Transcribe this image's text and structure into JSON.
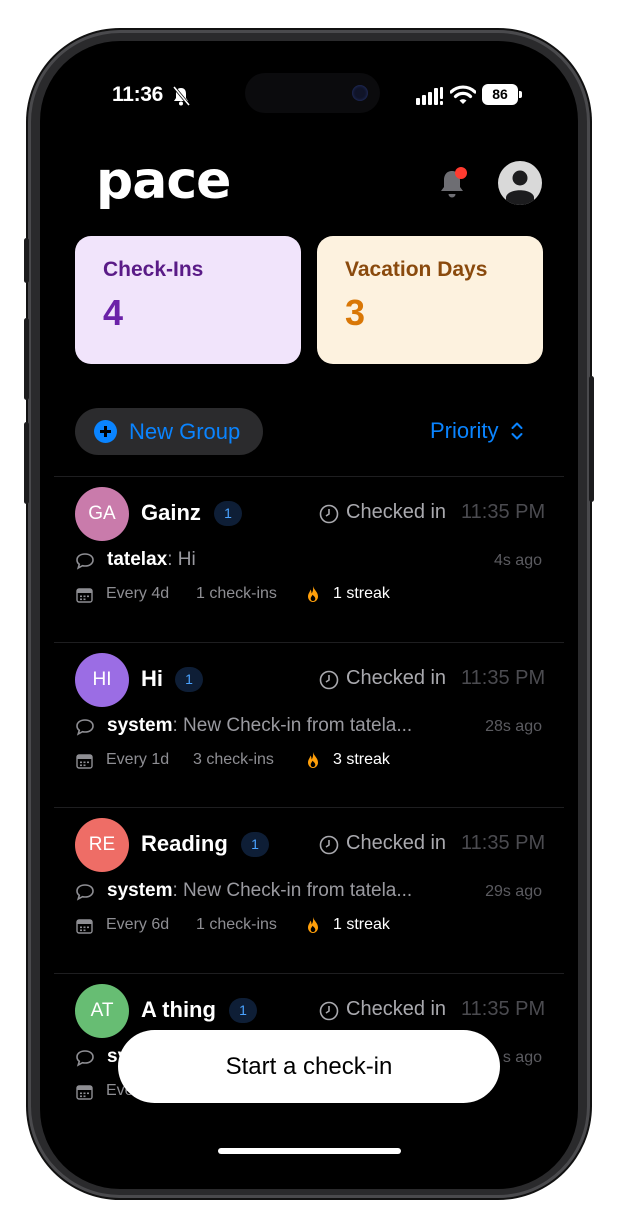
{
  "status_bar": {
    "time": "11:36",
    "battery": "86"
  },
  "header": {
    "logo": "pace"
  },
  "stats": {
    "checkins": {
      "title": "Check-Ins",
      "value": "4"
    },
    "vacation": {
      "title": "Vacation Days",
      "value": "3"
    }
  },
  "toolbar": {
    "new_group_label": "New Group",
    "sort_label": "Priority"
  },
  "groups": [
    {
      "initials": "GA",
      "color": "#c97bab",
      "name": "Gainz",
      "count": "1",
      "checked_label": "Checked in",
      "checked_time": "11:35 PM",
      "sender": "tatelax",
      "message": ": Hi",
      "ago": "4s ago",
      "frequency": "Every 4d",
      "checkins": "1 check-ins",
      "streak": "1 streak"
    },
    {
      "initials": "HI",
      "color": "#9b6de4",
      "name": "Hi",
      "count": "1",
      "checked_label": "Checked in",
      "checked_time": "11:35 PM",
      "sender": "system",
      "message": ": New Check-in from tatela...",
      "ago": "28s ago",
      "frequency": "Every 1d",
      "checkins": "3 check-ins",
      "streak": "3 streak"
    },
    {
      "initials": "RE",
      "color": "#ee6d66",
      "name": "Reading",
      "count": "1",
      "checked_label": "Checked in",
      "checked_time": "11:35 PM",
      "sender": "system",
      "message": ": New Check-in from tatela...",
      "ago": "29s ago",
      "frequency": "Every 6d",
      "checkins": "1 check-ins",
      "streak": "1 streak"
    },
    {
      "initials": "AT",
      "color": "#67bd73",
      "name": "A thing",
      "count": "1",
      "checked_label": "Checked in",
      "checked_time": "11:35 PM",
      "sender": "sy",
      "message": "",
      "ago": "s ago",
      "frequency": "Eve",
      "checkins": "",
      "streak": ""
    }
  ],
  "start_button": "Start a check-in",
  "colors": {
    "accent": "#0a84ff",
    "streak": "#ff9f0a",
    "notification_dot": "#ff3b30"
  }
}
